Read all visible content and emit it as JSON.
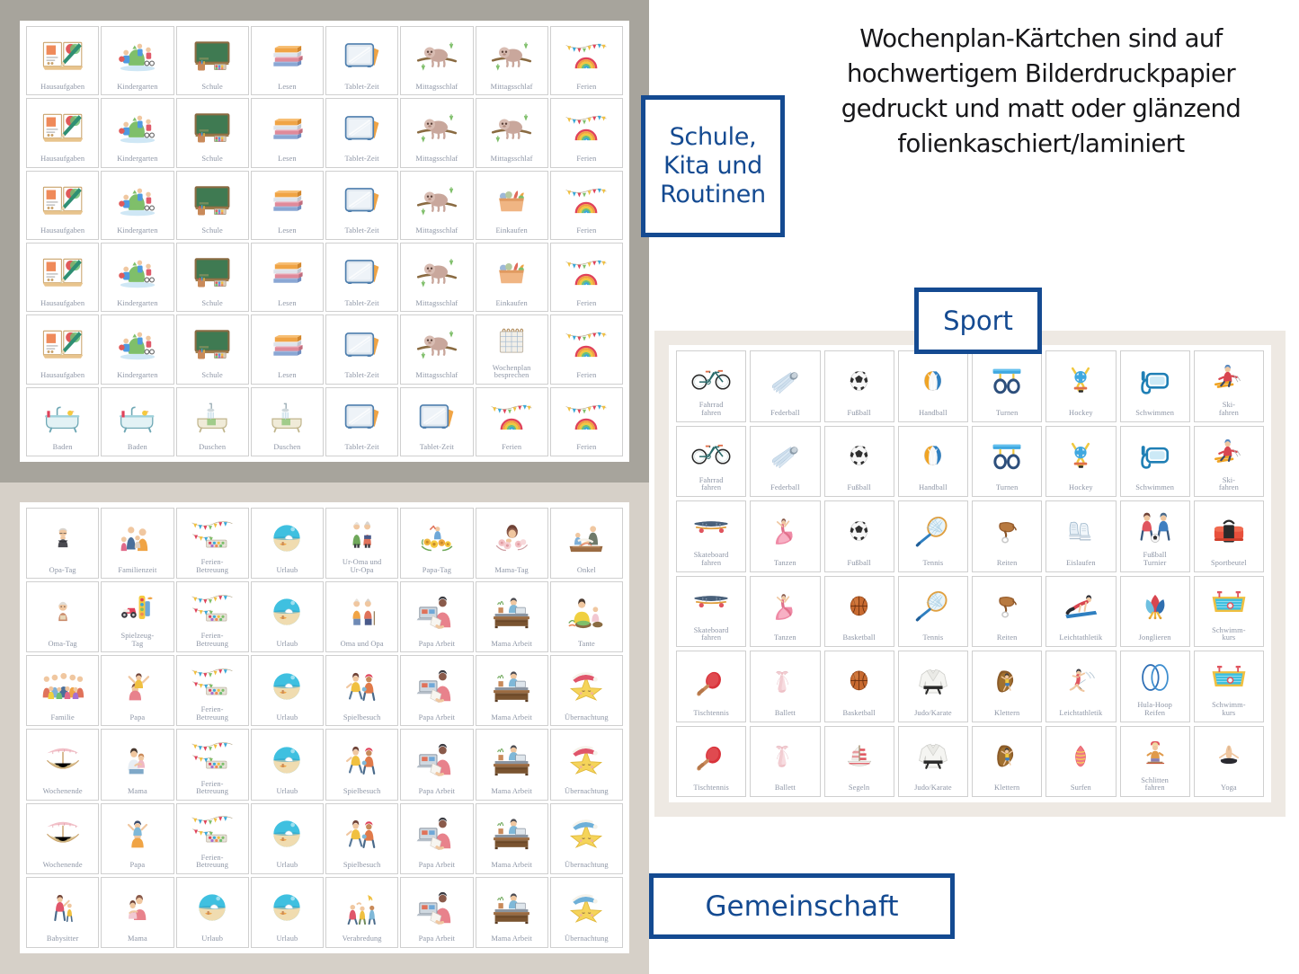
{
  "headline": "Wochenplan-Kärtchen sind auf hochwertigem Bilderdruckpapier gedruckt und matt oder glänzend folienkaschiert/laminiert",
  "badges": {
    "school": "Schule,\nKita und\nRoutinen",
    "sport": "Sport",
    "community": "Gemeinschaft"
  },
  "colors": {
    "badge_blue": "#144a91",
    "school_panel_bg": "#a7a49c",
    "community_panel_bg": "#d6d0c8",
    "sport_panel_bg": "#eee9e3",
    "card_label": "#8e96a6",
    "card_border": "#cfcfcf"
  },
  "sections": [
    {
      "id": "school",
      "name": "Schule, Kita und Routinen",
      "columns": 8,
      "rows": 6,
      "cards": [
        {
          "label": "Hausaufgaben",
          "icon": "open-book-pencil-icon"
        },
        {
          "label": "Kindergarten",
          "icon": "kids-playing-icon"
        },
        {
          "label": "Schule",
          "icon": "chalkboard-icon"
        },
        {
          "label": "Lesen",
          "icon": "book-stack-icon"
        },
        {
          "label": "Tablet-Zeit",
          "icon": "tablet-icon"
        },
        {
          "label": "Mittagsschlaf",
          "icon": "sloth-icon"
        },
        {
          "label": "Mittagsschlaf",
          "icon": "sloth-icon"
        },
        {
          "label": "Ferien",
          "icon": "rainbow-bunting-icon"
        },
        {
          "label": "Hausaufgaben",
          "icon": "open-book-pencil-icon"
        },
        {
          "label": "Kindergarten",
          "icon": "kids-playing-icon"
        },
        {
          "label": "Schule",
          "icon": "chalkboard-icon"
        },
        {
          "label": "Lesen",
          "icon": "book-stack-icon"
        },
        {
          "label": "Tablet-Zeit",
          "icon": "tablet-icon"
        },
        {
          "label": "Mittagsschlaf",
          "icon": "sloth-icon"
        },
        {
          "label": "Mittagsschlaf",
          "icon": "sloth-icon"
        },
        {
          "label": "Ferien",
          "icon": "rainbow-bunting-icon"
        },
        {
          "label": "Hausaufgaben",
          "icon": "open-book-pencil-icon"
        },
        {
          "label": "Kindergarten",
          "icon": "kids-playing-icon"
        },
        {
          "label": "Schule",
          "icon": "chalkboard-icon"
        },
        {
          "label": "Lesen",
          "icon": "book-stack-icon"
        },
        {
          "label": "Tablet-Zeit",
          "icon": "tablet-icon"
        },
        {
          "label": "Mittagsschlaf",
          "icon": "sloth-icon"
        },
        {
          "label": "Einkaufen",
          "icon": "grocery-bag-icon"
        },
        {
          "label": "Ferien",
          "icon": "rainbow-bunting-icon"
        },
        {
          "label": "Hausaufgaben",
          "icon": "open-book-pencil-icon"
        },
        {
          "label": "Kindergarten",
          "icon": "kids-playing-icon"
        },
        {
          "label": "Schule",
          "icon": "chalkboard-icon"
        },
        {
          "label": "Lesen",
          "icon": "book-stack-icon"
        },
        {
          "label": "Tablet-Zeit",
          "icon": "tablet-icon"
        },
        {
          "label": "Mittagsschlaf",
          "icon": "sloth-icon"
        },
        {
          "label": "Einkaufen",
          "icon": "grocery-bag-icon"
        },
        {
          "label": "Ferien",
          "icon": "rainbow-bunting-icon"
        },
        {
          "label": "Hausaufgaben",
          "icon": "open-book-pencil-icon"
        },
        {
          "label": "Kindergarten",
          "icon": "kids-playing-icon"
        },
        {
          "label": "Schule",
          "icon": "chalkboard-icon"
        },
        {
          "label": "Lesen",
          "icon": "book-stack-icon"
        },
        {
          "label": "Tablet-Zeit",
          "icon": "tablet-icon"
        },
        {
          "label": "Mittagsschlaf",
          "icon": "sloth-icon"
        },
        {
          "label": "Wochenplan\nbesprechen",
          "icon": "weekly-planner-icon"
        },
        {
          "label": "Ferien",
          "icon": "rainbow-bunting-icon"
        },
        {
          "label": "Baden",
          "icon": "bathtub-icon"
        },
        {
          "label": "Baden",
          "icon": "bathtub-icon"
        },
        {
          "label": "Duschen",
          "icon": "shower-icon"
        },
        {
          "label": "Duschen",
          "icon": "shower-icon"
        },
        {
          "label": "Tablet-Zeit",
          "icon": "tablet-icon"
        },
        {
          "label": "Tablet-Zeit",
          "icon": "tablet-icon"
        },
        {
          "label": "Ferien",
          "icon": "rainbow-bunting-icon"
        },
        {
          "label": "Ferien",
          "icon": "rainbow-bunting-icon"
        }
      ]
    },
    {
      "id": "community",
      "name": "Gemeinschaft",
      "columns": 8,
      "rows": 6,
      "cards": [
        {
          "label": "Opa-Tag",
          "icon": "grandfather-icon"
        },
        {
          "label": "Familienzeit",
          "icon": "family-group-icon"
        },
        {
          "label": "Ferien-\nBetreuung",
          "icon": "bunting-paint-icon"
        },
        {
          "label": "Urlaub",
          "icon": "beach-icon"
        },
        {
          "label": "Ur-Oma und\nUr-Opa",
          "icon": "great-grandparents-icon"
        },
        {
          "label": "Papa-Tag",
          "icon": "father-flowers-icon"
        },
        {
          "label": "Mama-Tag",
          "icon": "mother-flowers-icon"
        },
        {
          "label": "Onkel",
          "icon": "uncle-icon"
        },
        {
          "label": "Oma-Tag",
          "icon": "grandmother-icon"
        },
        {
          "label": "Spielzeug-\nTag",
          "icon": "toy-car-icon"
        },
        {
          "label": "Ferien-\nBetreuung",
          "icon": "bunting-paint-icon"
        },
        {
          "label": "Urlaub",
          "icon": "beach-icon"
        },
        {
          "label": "Oma und Opa",
          "icon": "grandparents-icon"
        },
        {
          "label": "Papa Arbeit",
          "icon": "father-working-icon"
        },
        {
          "label": "Mama Arbeit",
          "icon": "mother-desk-icon"
        },
        {
          "label": "Tante",
          "icon": "aunt-icon"
        },
        {
          "label": "Familie",
          "icon": "big-family-icon"
        },
        {
          "label": "Papa",
          "icon": "father-child-icon"
        },
        {
          "label": "Ferien-\nBetreuung",
          "icon": "bunting-paint-icon"
        },
        {
          "label": "Urlaub",
          "icon": "beach-icon"
        },
        {
          "label": "Spielbesuch",
          "icon": "kids-visit-icon"
        },
        {
          "label": "Papa Arbeit",
          "icon": "father-working-icon"
        },
        {
          "label": "Mama Arbeit",
          "icon": "mother-desk-icon"
        },
        {
          "label": "Übernachtung",
          "icon": "sleeping-star-red-icon"
        },
        {
          "label": "Wochenende",
          "icon": "hammock-icon"
        },
        {
          "label": "Mama",
          "icon": "mother-child-icon"
        },
        {
          "label": "Ferien-\nBetreuung",
          "icon": "bunting-paint-icon"
        },
        {
          "label": "Urlaub",
          "icon": "beach-icon"
        },
        {
          "label": "Spielbesuch",
          "icon": "kids-visit-icon"
        },
        {
          "label": "Papa Arbeit",
          "icon": "father-working-icon"
        },
        {
          "label": "Mama Arbeit",
          "icon": "mother-desk-icon"
        },
        {
          "label": "Übernachtung",
          "icon": "sleeping-star-red-icon"
        },
        {
          "label": "Wochenende",
          "icon": "hammock-icon"
        },
        {
          "label": "Papa",
          "icon": "father-shoulders-icon"
        },
        {
          "label": "Ferien-\nBetreuung",
          "icon": "bunting-paint-icon"
        },
        {
          "label": "Urlaub",
          "icon": "beach-icon"
        },
        {
          "label": "Spielbesuch",
          "icon": "kids-visit-icon"
        },
        {
          "label": "Papa Arbeit",
          "icon": "father-working-icon"
        },
        {
          "label": "Mama Arbeit",
          "icon": "mother-desk-icon"
        },
        {
          "label": "Übernachtung",
          "icon": "sleeping-star-blue-icon"
        },
        {
          "label": "Babysitter",
          "icon": "babysitter-icon"
        },
        {
          "label": "Mama",
          "icon": "mother-hug-icon"
        },
        {
          "label": "Urlaub",
          "icon": "beach-icon"
        },
        {
          "label": "Urlaub",
          "icon": "beach-icon"
        },
        {
          "label": "Verabredung",
          "icon": "playdate-icon"
        },
        {
          "label": "Papa Arbeit",
          "icon": "father-working-icon"
        },
        {
          "label": "Mama Arbeit",
          "icon": "mother-desk-icon"
        },
        {
          "label": "Übernachtung",
          "icon": "sleeping-star-blue-icon"
        }
      ]
    },
    {
      "id": "sport",
      "name": "Sport",
      "columns": 8,
      "rows": 6,
      "cards": [
        {
          "label": "Fahrrad\nfahren",
          "icon": "bicycle-icon"
        },
        {
          "label": "Federball",
          "icon": "shuttlecock-icon"
        },
        {
          "label": "Fußball",
          "icon": "soccer-ball-icon"
        },
        {
          "label": "Handball",
          "icon": "handball-icon"
        },
        {
          "label": "Turnen",
          "icon": "gym-rings-icon"
        },
        {
          "label": "Hockey",
          "icon": "hockey-icon"
        },
        {
          "label": "Schwimmen",
          "icon": "snorkel-mask-icon"
        },
        {
          "label": "Ski-\nfahren",
          "icon": "skier-icon"
        },
        {
          "label": "Fahrrad\nfahren",
          "icon": "bicycle-icon"
        },
        {
          "label": "Federball",
          "icon": "shuttlecock-icon"
        },
        {
          "label": "Fußball",
          "icon": "soccer-ball-icon"
        },
        {
          "label": "Handball",
          "icon": "handball-icon"
        },
        {
          "label": "Turnen",
          "icon": "gym-rings-icon"
        },
        {
          "label": "Hockey",
          "icon": "hockey-icon"
        },
        {
          "label": "Schwimmen",
          "icon": "snorkel-mask-icon"
        },
        {
          "label": "Ski-\nfahren",
          "icon": "skier-icon"
        },
        {
          "label": "Skateboard\nfahren",
          "icon": "skateboard-icon"
        },
        {
          "label": "Tanzen",
          "icon": "dancer-icon"
        },
        {
          "label": "Fußball",
          "icon": "soccer-ball-icon"
        },
        {
          "label": "Tennis",
          "icon": "tennis-racket-icon"
        },
        {
          "label": "Reiten",
          "icon": "saddle-icon"
        },
        {
          "label": "Eislaufen",
          "icon": "ice-skates-icon"
        },
        {
          "label": "Fußball\nTurnier",
          "icon": "soccer-kids-icon"
        },
        {
          "label": "Sportbeutel",
          "icon": "sports-bag-icon"
        },
        {
          "label": "Skateboard\nfahren",
          "icon": "skateboard-icon"
        },
        {
          "label": "Tanzen",
          "icon": "dancer-icon"
        },
        {
          "label": "Basketball",
          "icon": "basketball-icon"
        },
        {
          "label": "Tennis",
          "icon": "tennis-racket-icon"
        },
        {
          "label": "Reiten",
          "icon": "saddle-icon"
        },
        {
          "label": "Leichtathletik",
          "icon": "plank-athlete-icon"
        },
        {
          "label": "Jonglieren",
          "icon": "juggling-clubs-icon"
        },
        {
          "label": "Schwimm-\nkurs",
          "icon": "swimming-pool-icon"
        },
        {
          "label": "Tischtennis",
          "icon": "table-tennis-icon"
        },
        {
          "label": "Ballett",
          "icon": "ballet-shoes-icon"
        },
        {
          "label": "Basketball",
          "icon": "basketball-icon"
        },
        {
          "label": "Judo/Karate",
          "icon": "judo-gi-icon"
        },
        {
          "label": "Klettern",
          "icon": "climbing-icon"
        },
        {
          "label": "Leichtathletik",
          "icon": "gymnast-icon"
        },
        {
          "label": "Hula-Hoop\nReifen",
          "icon": "hula-hoop-icon"
        },
        {
          "label": "Schwimm-\nkurs",
          "icon": "swimming-pool-icon"
        },
        {
          "label": "Tischtennis",
          "icon": "table-tennis-icon"
        },
        {
          "label": "Ballett",
          "icon": "ballet-shoes-icon"
        },
        {
          "label": "Segeln",
          "icon": "sailboat-icon"
        },
        {
          "label": "Judo/Karate",
          "icon": "judo-gi-icon"
        },
        {
          "label": "Klettern",
          "icon": "climbing-icon"
        },
        {
          "label": "Surfen",
          "icon": "surfboard-icon"
        },
        {
          "label": "Schlitten\nfahren",
          "icon": "sledding-icon"
        },
        {
          "label": "Yoga",
          "icon": "yoga-icon"
        }
      ]
    }
  ]
}
